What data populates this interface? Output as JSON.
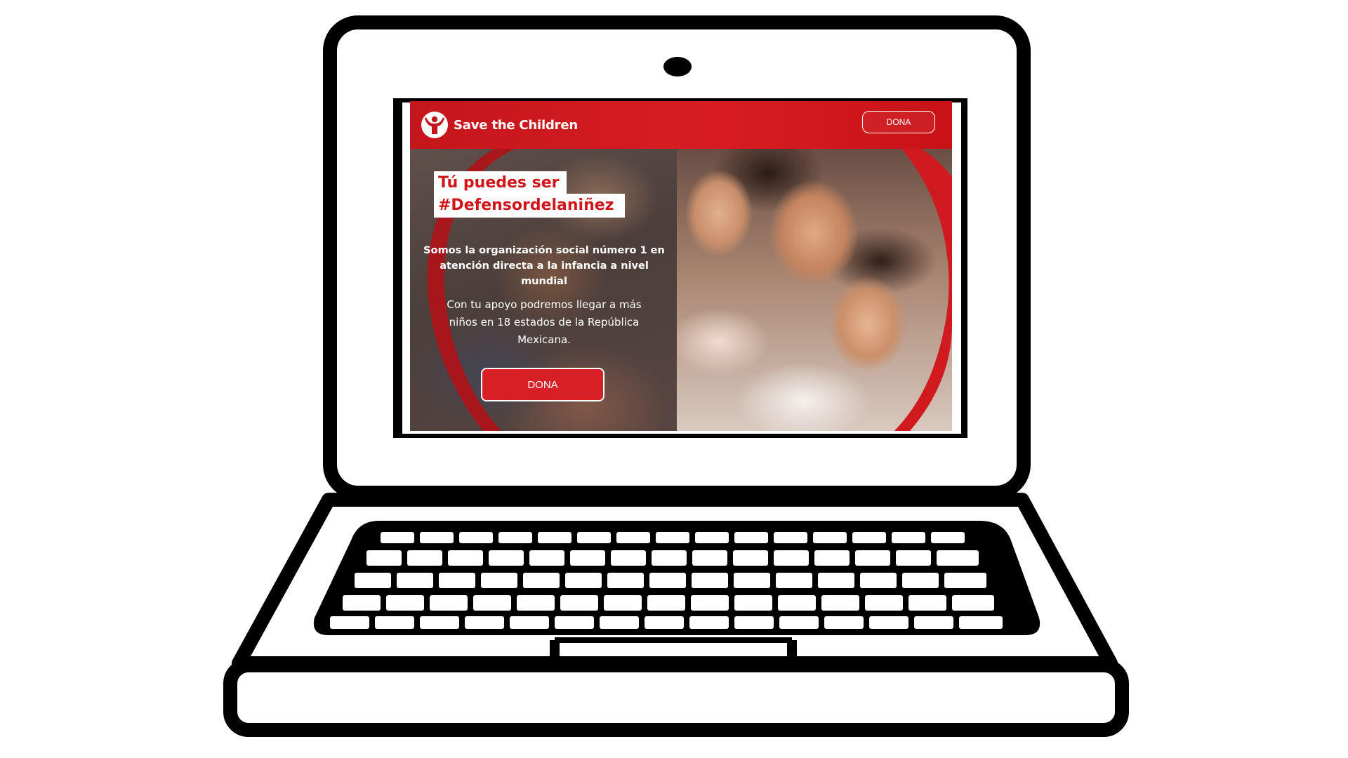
{
  "brand": {
    "logo_text": "Save the Children",
    "color_primary": "#d71f26",
    "color_header": "#c4161c"
  },
  "header": {
    "cta_label": "DONA"
  },
  "hero": {
    "headline_line1": "Tú puedes ser",
    "headline_line2": "#Defensordelaniñez",
    "lead": "Somos la organización social número 1 en atención directa a la infancia a nivel mundial",
    "body": "Con tu apoyo podremos llegar a más niños en 18 estados de la República Mexicana.",
    "cta_label": "DONA"
  },
  "icons": {
    "logo": "child-raising-arms-icon",
    "webcam": "webcam-icon"
  }
}
